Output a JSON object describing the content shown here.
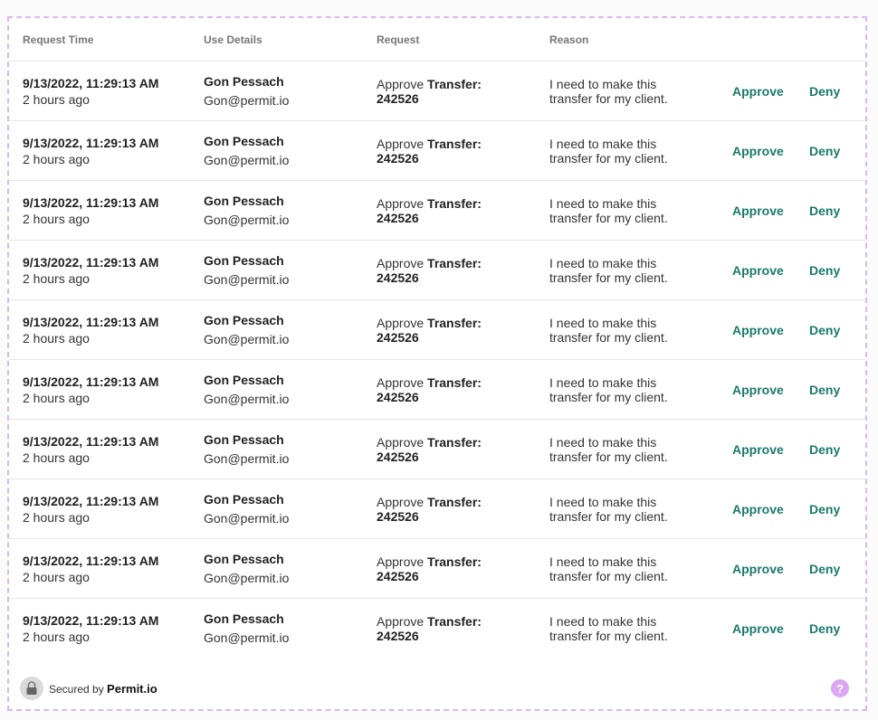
{
  "table": {
    "headers": {
      "request_time": "Request Time",
      "use_details": "Use Details",
      "request": "Request",
      "reason": "Reason"
    },
    "rows": [
      {
        "time": "9/13/2022, 11:29:13 AM",
        "ago": "2 hours ago",
        "name": "Gon Pessach",
        "email": "Gon@permit.io",
        "request_prefix": "Approve",
        "request_label": "Transfer:",
        "request_id": "242526",
        "reason_line1": "I need to make this",
        "reason_line2": "transfer for my client.",
        "approve": "Approve",
        "deny": "Deny"
      },
      {
        "time": "9/13/2022, 11:29:13 AM",
        "ago": "2 hours ago",
        "name": "Gon Pessach",
        "email": "Gon@permit.io",
        "request_prefix": "Approve",
        "request_label": "Transfer:",
        "request_id": "242526",
        "reason_line1": "I need to make this",
        "reason_line2": "transfer for my client.",
        "approve": "Approve",
        "deny": "Deny"
      },
      {
        "time": "9/13/2022, 11:29:13 AM",
        "ago": "2 hours ago",
        "name": "Gon Pessach",
        "email": "Gon@permit.io",
        "request_prefix": "Approve",
        "request_label": "Transfer:",
        "request_id": "242526",
        "reason_line1": "I need to make this",
        "reason_line2": "transfer for my client.",
        "approve": "Approve",
        "deny": "Deny"
      },
      {
        "time": "9/13/2022, 11:29:13 AM",
        "ago": "2 hours ago",
        "name": "Gon Pessach",
        "email": "Gon@permit.io",
        "request_prefix": "Approve",
        "request_label": "Transfer:",
        "request_id": "242526",
        "reason_line1": "I need to make this",
        "reason_line2": "transfer for my client.",
        "approve": "Approve",
        "deny": "Deny"
      },
      {
        "time": "9/13/2022, 11:29:13 AM",
        "ago": "2 hours ago",
        "name": "Gon Pessach",
        "email": "Gon@permit.io",
        "request_prefix": "Approve",
        "request_label": "Transfer:",
        "request_id": "242526",
        "reason_line1": "I need to make this",
        "reason_line2": "transfer for my client.",
        "approve": "Approve",
        "deny": "Deny"
      },
      {
        "time": "9/13/2022, 11:29:13 AM",
        "ago": "2 hours ago",
        "name": "Gon Pessach",
        "email": "Gon@permit.io",
        "request_prefix": "Approve",
        "request_label": "Transfer:",
        "request_id": "242526",
        "reason_line1": "I need to make this",
        "reason_line2": "transfer for my client.",
        "approve": "Approve",
        "deny": "Deny"
      },
      {
        "time": "9/13/2022, 11:29:13 AM",
        "ago": "2 hours ago",
        "name": "Gon Pessach",
        "email": "Gon@permit.io",
        "request_prefix": "Approve",
        "request_label": "Transfer:",
        "request_id": "242526",
        "reason_line1": "I need to make this",
        "reason_line2": "transfer for my client.",
        "approve": "Approve",
        "deny": "Deny"
      },
      {
        "time": "9/13/2022, 11:29:13 AM",
        "ago": "2 hours ago",
        "name": "Gon Pessach",
        "email": "Gon@permit.io",
        "request_prefix": "Approve",
        "request_label": "Transfer:",
        "request_id": "242526",
        "reason_line1": "I need to make this",
        "reason_line2": "transfer for my client.",
        "approve": "Approve",
        "deny": "Deny"
      },
      {
        "time": "9/13/2022, 11:29:13 AM",
        "ago": "2 hours ago",
        "name": "Gon Pessach",
        "email": "Gon@permit.io",
        "request_prefix": "Approve",
        "request_label": "Transfer:",
        "request_id": "242526",
        "reason_line1": "I need to make this",
        "reason_line2": "transfer for my client.",
        "approve": "Approve",
        "deny": "Deny"
      },
      {
        "time": "9/13/2022, 11:29:13 AM",
        "ago": "2 hours ago",
        "name": "Gon Pessach",
        "email": "Gon@permit.io",
        "request_prefix": "Approve",
        "request_label": "Transfer:",
        "request_id": "242526",
        "reason_line1": "I need to make this",
        "reason_line2": "transfer for my client.",
        "approve": "Approve",
        "deny": "Deny"
      }
    ]
  },
  "footer": {
    "secured_by": "Secured by",
    "brand": "Permit.io",
    "help_symbol": "?",
    "lock_icon": "lock-icon",
    "help_icon": "help-icon"
  },
  "colors": {
    "action": "#1a7a6a",
    "frame_border": "#d8b8f0",
    "help_badge": "#d9a8f2"
  }
}
